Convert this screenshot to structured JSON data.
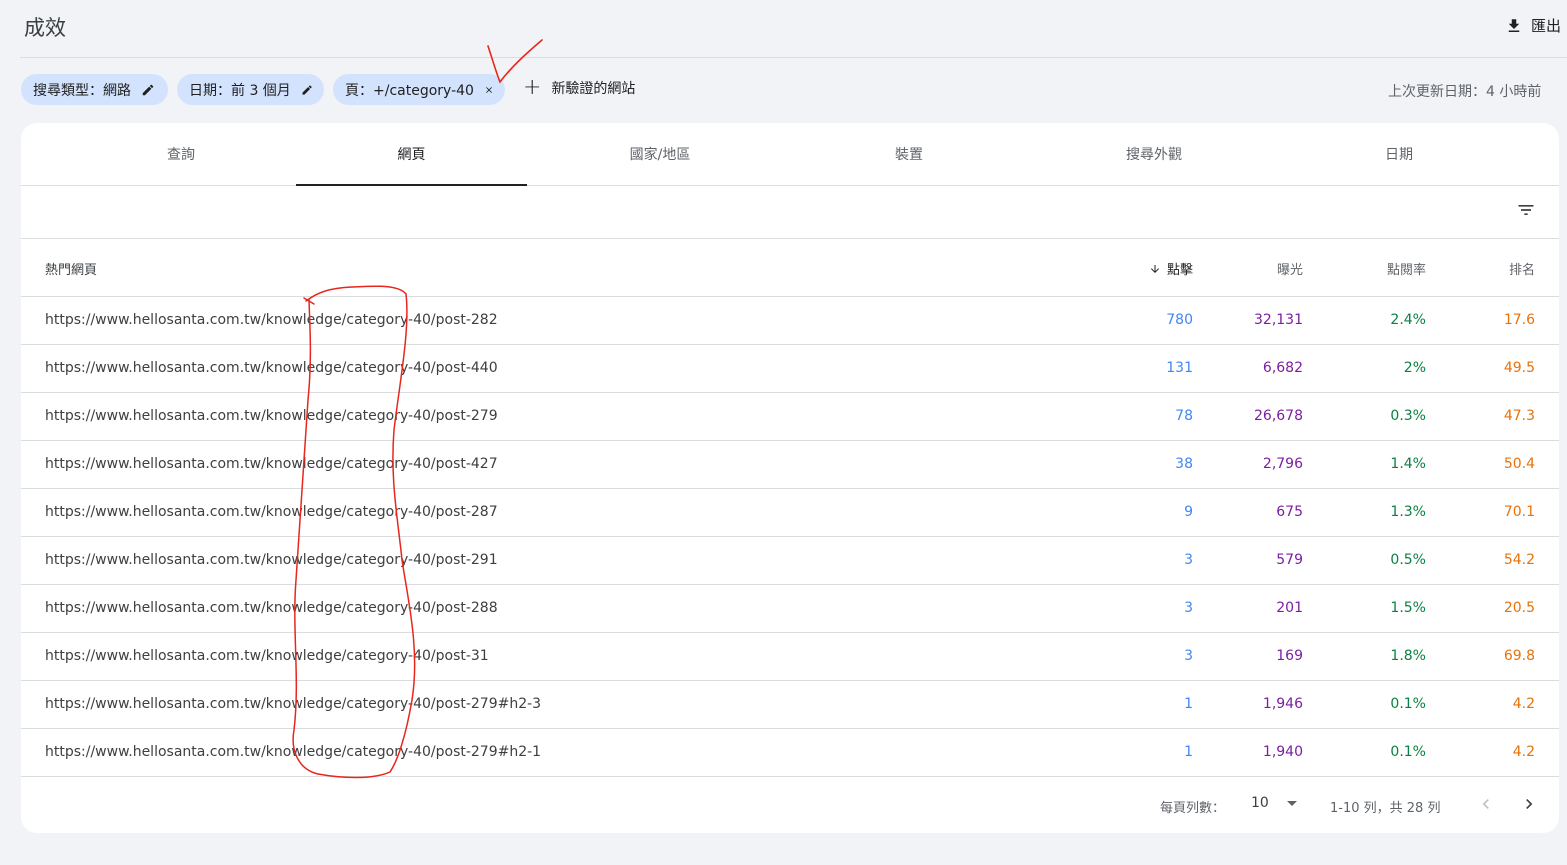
{
  "header": {
    "title": "成效",
    "export_label": "匯出"
  },
  "filters": {
    "chips": [
      {
        "label": "搜尋類型：網路",
        "icon": "pencil-icon"
      },
      {
        "label": "日期：前 3 個月",
        "icon": "pencil-icon"
      },
      {
        "label": "頁：+/category-40",
        "icon": "close-icon"
      }
    ],
    "add_label": "新驗證的網站",
    "last_updated": "上次更新日期：4 小時前"
  },
  "tabs": [
    {
      "label": "查詢",
      "active": false
    },
    {
      "label": "網頁",
      "active": true
    },
    {
      "label": "國家/地區",
      "active": false
    },
    {
      "label": "裝置",
      "active": false
    },
    {
      "label": "搜尋外觀",
      "active": false
    },
    {
      "label": "日期",
      "active": false
    }
  ],
  "table": {
    "headers": {
      "page": "熱門網頁",
      "clicks": "點擊",
      "impressions": "曝光",
      "ctr": "點閱率",
      "position": "排名"
    },
    "sort_column": "clicks",
    "rows": [
      {
        "url": "https://www.hellosanta.com.tw/knowledge/category-40/post-282",
        "clicks": "780",
        "impressions": "32,131",
        "ctr": "2.4%",
        "position": "17.6"
      },
      {
        "url": "https://www.hellosanta.com.tw/knowledge/category-40/post-440",
        "clicks": "131",
        "impressions": "6,682",
        "ctr": "2%",
        "position": "49.5"
      },
      {
        "url": "https://www.hellosanta.com.tw/knowledge/category-40/post-279",
        "clicks": "78",
        "impressions": "26,678",
        "ctr": "0.3%",
        "position": "47.3"
      },
      {
        "url": "https://www.hellosanta.com.tw/knowledge/category-40/post-427",
        "clicks": "38",
        "impressions": "2,796",
        "ctr": "1.4%",
        "position": "50.4"
      },
      {
        "url": "https://www.hellosanta.com.tw/knowledge/category-40/post-287",
        "clicks": "9",
        "impressions": "675",
        "ctr": "1.3%",
        "position": "70.1"
      },
      {
        "url": "https://www.hellosanta.com.tw/knowledge/category-40/post-291",
        "clicks": "3",
        "impressions": "579",
        "ctr": "0.5%",
        "position": "54.2"
      },
      {
        "url": "https://www.hellosanta.com.tw/knowledge/category-40/post-288",
        "clicks": "3",
        "impressions": "201",
        "ctr": "1.5%",
        "position": "20.5"
      },
      {
        "url": "https://www.hellosanta.com.tw/knowledge/category-40/post-31",
        "clicks": "3",
        "impressions": "169",
        "ctr": "1.8%",
        "position": "69.8"
      },
      {
        "url": "https://www.hellosanta.com.tw/knowledge/category-40/post-279#h2-3",
        "clicks": "1",
        "impressions": "1,946",
        "ctr": "0.1%",
        "position": "4.2"
      },
      {
        "url": "https://www.hellosanta.com.tw/knowledge/category-40/post-279#h2-1",
        "clicks": "1",
        "impressions": "1,940",
        "ctr": "0.1%",
        "position": "4.2"
      }
    ]
  },
  "pagination": {
    "rows_per_page_label": "每頁列數：",
    "rows_per_page": "10",
    "range": "1-10 列，共 28 列"
  },
  "colors": {
    "clicks": "#4285f4",
    "impressions": "#7b1fa2",
    "ctr": "#0b8043",
    "position": "#e8710a",
    "chip_bg": "#d3e3fd",
    "annotation": "#e8261c"
  }
}
